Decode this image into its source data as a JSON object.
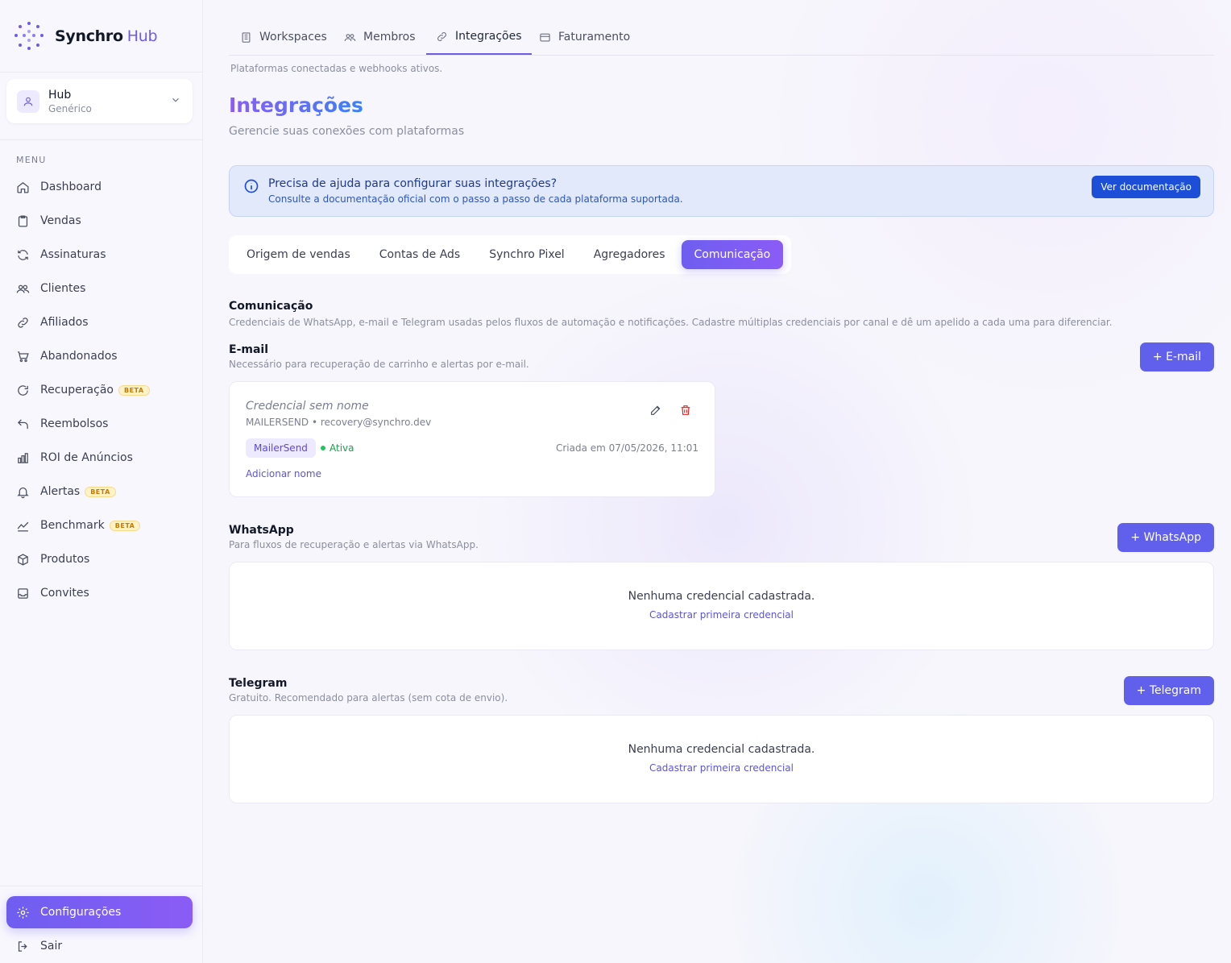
{
  "brand": {
    "name": "Synchro",
    "suffix": "Hub"
  },
  "workspace": {
    "title": "Hub",
    "subtitle": "Genérico"
  },
  "sidebar": {
    "menu_label": "MENU",
    "items": [
      {
        "label": "Dashboard",
        "icon": "home-icon"
      },
      {
        "label": "Vendas",
        "icon": "clipboard-icon"
      },
      {
        "label": "Assinaturas",
        "icon": "refresh-icon"
      },
      {
        "label": "Clientes",
        "icon": "users-icon"
      },
      {
        "label": "Afiliados",
        "icon": "link-icon"
      },
      {
        "label": "Abandonados",
        "icon": "cart-icon"
      },
      {
        "label": "Recuperação",
        "icon": "rotate-icon",
        "badge": "BETA"
      },
      {
        "label": "Reembolsos",
        "icon": "undo-icon"
      },
      {
        "label": "ROI de Anúncios",
        "icon": "bar-chart-icon"
      },
      {
        "label": "Alertas",
        "icon": "bell-icon",
        "badge": "BETA"
      },
      {
        "label": "Benchmark",
        "icon": "trend-icon",
        "badge": "BETA"
      },
      {
        "label": "Produtos",
        "icon": "box-icon"
      },
      {
        "label": "Convites",
        "icon": "inbox-icon"
      }
    ],
    "settings_label": "Configurações",
    "logout_label": "Sair"
  },
  "top_tabs": [
    {
      "label": "Workspaces",
      "icon": "building-icon"
    },
    {
      "label": "Membros",
      "icon": "users-icon"
    },
    {
      "label": "Integrações",
      "icon": "link-icon",
      "active": true
    },
    {
      "label": "Faturamento",
      "icon": "card-icon"
    }
  ],
  "tab_caption": "Plataformas conectadas e webhooks ativos.",
  "page": {
    "title": "Integrações",
    "subtitle": "Gerencie suas conexões com plataformas"
  },
  "help": {
    "title": "Precisa de ajuda para configurar suas integrações?",
    "desc": "Consulte a documentação oficial com o passo a passo de cada plataforma suportada.",
    "button": "Ver documentação"
  },
  "category_tabs": [
    "Origem de vendas",
    "Contas de Ads",
    "Synchro Pixel",
    "Agregadores",
    "Comunicação"
  ],
  "active_category": "Comunicação",
  "communication": {
    "title": "Comunicação",
    "desc": "Credenciais de WhatsApp, e-mail e Telegram usadas pelos fluxos de automação e notificações. Cadastre múltiplas credenciais por canal e dê um apelido a cada uma para diferenciar."
  },
  "email": {
    "title": "E-mail",
    "desc": "Necessário para recuperação de carrinho e alertas por e-mail.",
    "add_button": "+ E-mail",
    "credential": {
      "name": "Credencial sem nome",
      "meta": "MAILERSEND • recovery@synchro.dev",
      "badge": "MailerSend",
      "status": "Ativa",
      "created": "Criada em 07/05/2026, 11:01",
      "add_name": "Adicionar nome"
    }
  },
  "whatsapp": {
    "title": "WhatsApp",
    "desc": "Para fluxos de recuperação e alertas via WhatsApp.",
    "add_button": "+ WhatsApp",
    "empty": "Nenhuma credencial cadastrada.",
    "empty_link": "Cadastrar primeira credencial"
  },
  "telegram": {
    "title": "Telegram",
    "desc": "Gratuito. Recomendado para alertas (sem cota de envio).",
    "add_button": "+ Telegram",
    "empty": "Nenhuma credencial cadastrada.",
    "empty_link": "Cadastrar primeira credencial"
  },
  "colors": {
    "accent": "#6E5EF0",
    "info": "#1D4ED8",
    "success": "#16A34A",
    "danger": "#DC2626"
  }
}
